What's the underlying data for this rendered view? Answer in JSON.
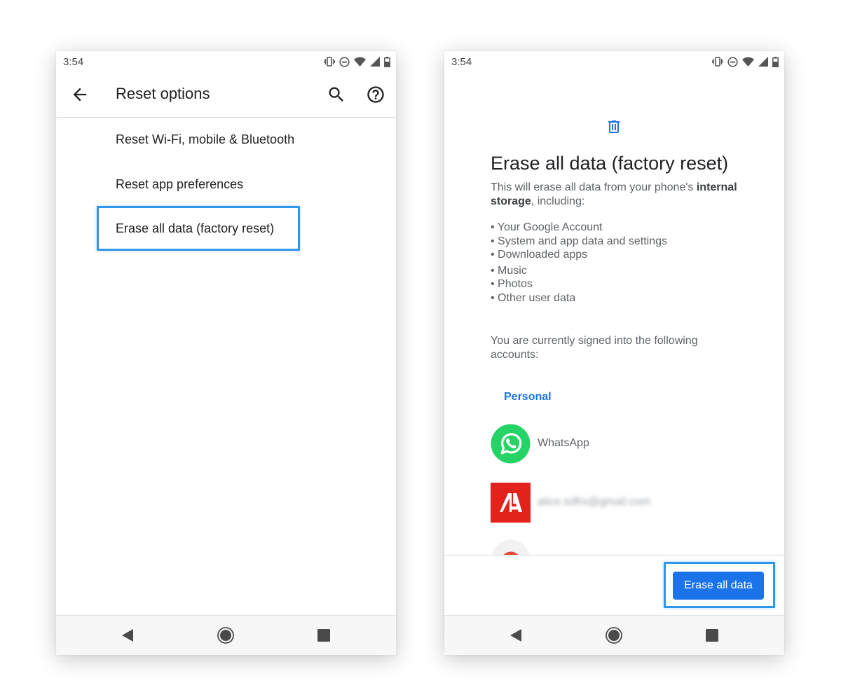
{
  "left_screen": {
    "status": {
      "time": "3:54"
    },
    "app_bar": {
      "title": "Reset options"
    },
    "menu": [
      {
        "label": "Reset Wi-Fi, mobile & Bluetooth"
      },
      {
        "label": "Reset app preferences"
      },
      {
        "label": "Erase all data (factory reset)"
      }
    ]
  },
  "right_screen": {
    "status": {
      "time": "3:54"
    },
    "title": "Erase all data (factory reset)",
    "description": {
      "part1": "This will erase all data from your phone's ",
      "bold1": "internal storage",
      "part2": ", including:"
    },
    "bullets": [
      "• Your Google Account",
      "• System and app data and settings",
      "• Downloaded apps",
      "• Music",
      "• Photos",
      "• Other user data"
    ],
    "signed_in_text": "You are currently signed into the following accounts:",
    "account_section": "Personal",
    "accounts": [
      {
        "name": "WhatsApp",
        "icon": "whatsapp-icon"
      },
      {
        "name": "alice.sdfrs@gmail.com",
        "icon": "adobe-icon"
      },
      {
        "name": "",
        "icon": "account-icon"
      }
    ],
    "erase_button_label": "Erase all data"
  },
  "colors": {
    "accent_blue": "#1a73e8",
    "highlight_box": "#2f97e8",
    "whatsapp_green": "#25d366",
    "adobe_red": "#e3221c"
  },
  "icons": {
    "status": [
      "vibrate-icon",
      "do-not-disturb-icon",
      "wifi-icon",
      "signal-icon",
      "battery-icon"
    ],
    "nav": [
      "back-triangle-icon",
      "home-circle-icon",
      "recents-square-icon"
    ]
  }
}
